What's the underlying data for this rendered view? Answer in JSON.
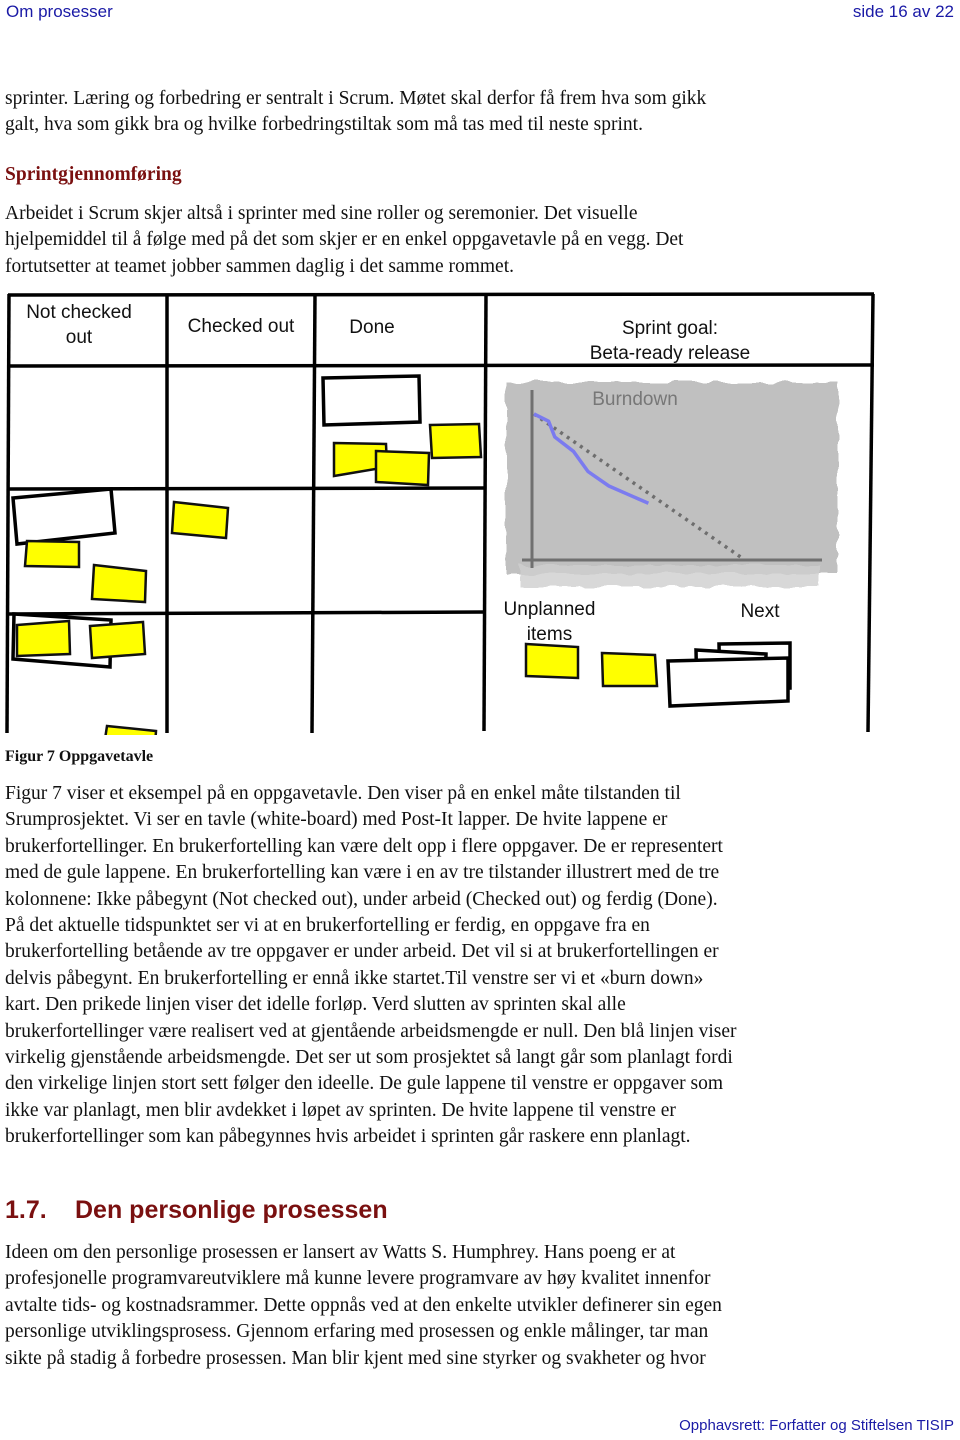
{
  "header": {
    "title": "Om prosesser",
    "page_indicator": "side 16 av 22"
  },
  "intro_paragraph": [
    "sprinter. Læring og forbedring er sentralt i Scrum. Møtet skal derfor få frem hva som gikk",
    "galt, hva som gikk bra og hvilke forbedringstiltak som må tas med til neste sprint."
  ],
  "subsection": {
    "title": "Sprintgjennomføring",
    "paragraph": [
      "Arbeidet i Scrum skjer altså i sprinter med sine roller og seremonier. Det visuelle",
      "hjelpemiddel til å følge med på det som skjer er en enkel oppgavetavle på en vegg. Det",
      "fortutsetter at teamet jobber sammen daglig i det samme rommet."
    ]
  },
  "figure": {
    "caption": "Figur 7 Oppgavetavle",
    "columns": [
      "Not checked\nout",
      "Checked out",
      "Done"
    ],
    "column_lines": [
      [
        "Not checked",
        "out"
      ],
      [
        "Checked out"
      ],
      [
        "Done"
      ]
    ],
    "sprint_goal": [
      "Sprint goal:",
      "Beta-ready release"
    ],
    "burndown_title": "Burndown",
    "unplanned_label": [
      "Unplanned",
      "items"
    ],
    "next_label": "Next",
    "colors": {
      "sticky_yellow": "#ffff00",
      "burndown_bg": "#c0c0c0",
      "actual_line": "#7b7bef",
      "ideal_line": "#6e6e6e",
      "border": "#000000"
    },
    "rows": [
      {
        "not_checked_out": {
          "stories": 0,
          "tasks": 0
        },
        "checked_out": {
          "tasks": 0
        },
        "done": {
          "stories": 1,
          "tasks": 3
        }
      },
      {
        "not_checked_out": {
          "stories": 1,
          "tasks": 2
        },
        "checked_out": {
          "tasks": 1
        },
        "done": {
          "stories": 0,
          "tasks": 0
        }
      },
      {
        "not_checked_out": {
          "stories": 1,
          "tasks": 3
        },
        "checked_out": {
          "tasks": 0
        },
        "done": {
          "stories": 0,
          "tasks": 0
        }
      }
    ],
    "unplanned_items_count": 2,
    "next_items_count": 3,
    "burndown": {
      "ideal": [
        [
          0,
          100
        ],
        [
          1,
          0
        ]
      ],
      "actual": [
        [
          0,
          100
        ],
        [
          0.07,
          95
        ],
        [
          0.1,
          84
        ],
        [
          0.19,
          74
        ],
        [
          0.26,
          60
        ],
        [
          0.36,
          50
        ],
        [
          0.55,
          38
        ]
      ]
    }
  },
  "figure_paragraph": [
    "Figur 7 viser et eksempel på en oppgavetavle. Den viser på en enkel måte tilstanden til",
    "Srumprosjektet. Vi ser en tavle (white-board) med Post-It lapper. De hvite lappene er",
    "brukerfortellinger. En brukerfortelling kan være delt opp i flere oppgaver. De er representert",
    "med de gule lappene. En brukerfortelling kan være i en av tre tilstander illustrert med de tre",
    "kolonnene: Ikke påbegynt (Not checked out), under arbeid (Checked out) og ferdig (Done).",
    "På det aktuelle tidspunktet ser vi at en brukerfortelling er ferdig, en oppgave fra en",
    "brukerfortelling betående av tre oppgaver er under arbeid. Det vil si at brukerfortellingen er",
    "delvis påbegynt. En brukerfortelling er ennå ikke startet.Til venstre ser vi et «burn down»",
    "kart. Den prikede linjen viser det idelle forløp. Verd slutten av sprinten skal alle",
    "brukerfortellinger være realisert ved at gjentående arbeidsmengde er null. Den blå linjen viser",
    "virkelig gjenstående arbeidsmengde. Det ser ut som prosjektet så langt går som planlagt fordi",
    "den virkelige linjen stort sett følger den ideelle. De gule lappene til venstre er oppgaver som",
    "ikke var planlagt, men blir avdekket i løpet av sprinten. De hvite lappene til venstre er",
    "brukerfortellinger som kan påbegynnes hvis arbeidet i sprinten går raskere enn planlagt."
  ],
  "section": {
    "number": "1.7.",
    "title": "Den personlige prosessen",
    "paragraph": [
      "Ideen om den personlige prosessen er lansert av Watts S. Humphrey. Hans poeng er at",
      "profesjonelle programvareutviklere må kunne levere programvare av høy kvalitet innenfor",
      "avtalte tids- og kostnadsrammer. Dette oppnås ved at den enkelte utvikler definerer sin egen",
      "personlige utviklingsprosess. Gjennom erfaring med prosessen og enkle målinger, tar man",
      "sikte på stadig å forbedre prosessen. Man blir kjent med sine styrker og svakheter og hvor"
    ]
  },
  "footer": {
    "copyright": "Opphavsrett:  Forfatter og Stiftelsen TISIP"
  }
}
